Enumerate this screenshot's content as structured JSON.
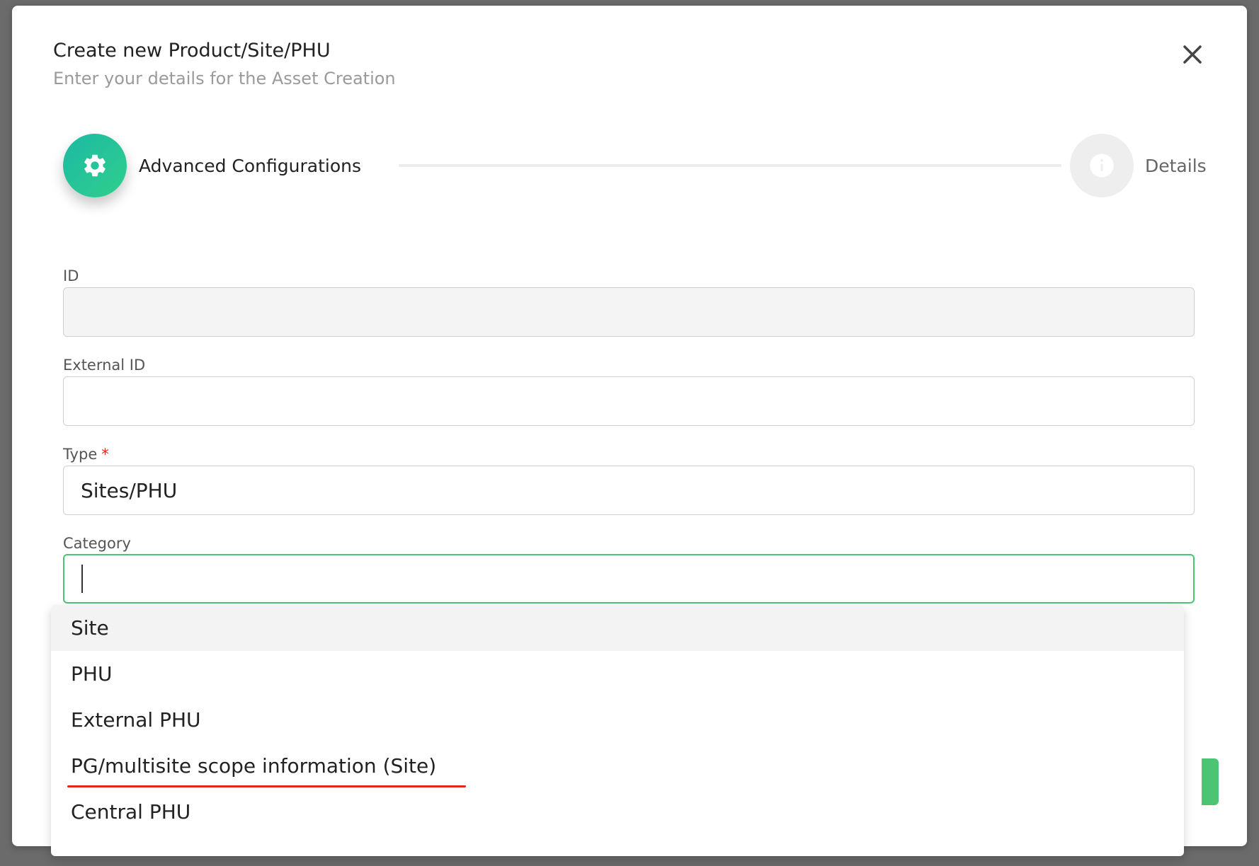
{
  "modal": {
    "title": "Create new Product/Site/PHU",
    "subtitle": "Enter your details for the Asset Creation",
    "close_icon": "close-icon"
  },
  "stepper": {
    "steps": [
      {
        "label": "Advanced Configurations",
        "icon": "gear-icon",
        "state": "active"
      },
      {
        "label": "Details",
        "icon": "info-icon",
        "state": "inactive"
      }
    ]
  },
  "form": {
    "id": {
      "label": "ID",
      "value": ""
    },
    "external_id": {
      "label": "External ID",
      "value": ""
    },
    "type": {
      "label": "Type",
      "required_mark": "*",
      "value": "Sites/PHU"
    },
    "category": {
      "label": "Category",
      "value": ""
    }
  },
  "category_dropdown": {
    "options": [
      {
        "label": "Site"
      },
      {
        "label": "PHU"
      },
      {
        "label": "External PHU"
      },
      {
        "label": "PG/multisite scope information (Site)"
      },
      {
        "label": "Central PHU"
      }
    ]
  },
  "colors": {
    "accent_green": "#4cc474",
    "gradient_start": "#1db9a4",
    "required_red": "#e0261f"
  }
}
